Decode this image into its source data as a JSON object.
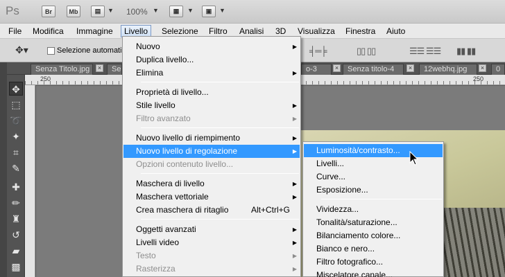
{
  "appbar": {
    "logo": "Ps",
    "br": "Br",
    "mb": "Mb",
    "zoom": "100%"
  },
  "menubar": {
    "items": [
      "File",
      "Modifica",
      "Immagine",
      "Livello",
      "Selezione",
      "Filtro",
      "Analisi",
      "3D",
      "Visualizza",
      "Finestra",
      "Aiuto"
    ]
  },
  "options": {
    "auto_select_label": "Selezione automatica"
  },
  "tabs": [
    {
      "label": "Senza Titolo.jpg"
    },
    {
      "label": "Se"
    },
    {
      "label": "o-3"
    },
    {
      "label": "Senza titolo-4"
    },
    {
      "label": "12webhq.jpg"
    },
    {
      "label": "0"
    }
  ],
  "ruler": {
    "left_label": "250",
    "right_label": "250"
  },
  "menu": {
    "items": [
      {
        "label": "Nuovo",
        "submenu": true
      },
      {
        "label": "Duplica livello..."
      },
      {
        "label": "Elimina",
        "submenu": true
      },
      {
        "label": "Proprietà di livello..."
      },
      {
        "label": "Stile livello",
        "submenu": true
      },
      {
        "label": "Filtro avanzato",
        "disabled": true,
        "submenu": true
      },
      {
        "label": "Nuovo livello di riempimento",
        "submenu": true
      },
      {
        "label": "Nuovo livello di regolazione",
        "submenu": true,
        "highlighted": true
      },
      {
        "label": "Opzioni contenuto livello...",
        "disabled": true
      },
      {
        "label": "Maschera di livello",
        "submenu": true
      },
      {
        "label": "Maschera vettoriale",
        "submenu": true
      },
      {
        "label": "Crea maschera di ritaglio",
        "shortcut": "Alt+Ctrl+G"
      },
      {
        "label": "Oggetti avanzati",
        "submenu": true
      },
      {
        "label": "Livelli video",
        "submenu": true
      },
      {
        "label": "Testo",
        "disabled": true,
        "submenu": true
      },
      {
        "label": "Rasterizza",
        "disabled": true,
        "submenu": true
      }
    ]
  },
  "submenu": {
    "items": [
      {
        "label": "Luminosità/contrasto...",
        "highlighted": true
      },
      {
        "label": "Livelli..."
      },
      {
        "label": "Curve..."
      },
      {
        "label": "Esposizione..."
      },
      {
        "label": "Vividezza..."
      },
      {
        "label": "Tonalità/saturazione..."
      },
      {
        "label": "Bilanciamento colore..."
      },
      {
        "label": "Bianco e nero..."
      },
      {
        "label": "Filtro fotografico..."
      },
      {
        "label": "Miscelatore canale..."
      }
    ]
  },
  "colors": {
    "highlight": "#3399ff",
    "menu_bg": "#f0f0f0",
    "disabled_text": "#8d8d8d"
  }
}
